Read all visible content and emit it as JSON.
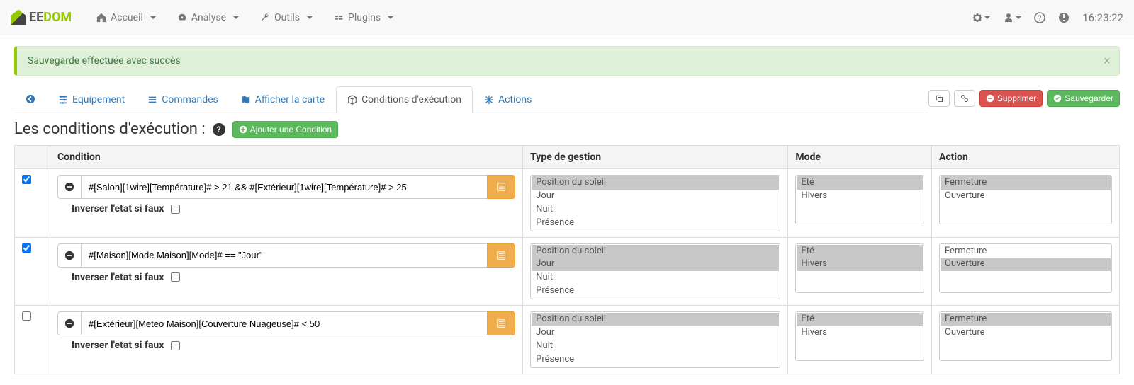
{
  "nav": {
    "home": "Accueil",
    "analyse": "Analyse",
    "tools": "Outils",
    "plugins": "Plugins"
  },
  "topright": {
    "time": "16:23:22"
  },
  "alert": {
    "message": "Sauvegarde effectuée avec succès"
  },
  "tabs": {
    "equipment": "Equipement",
    "commands": "Commandes",
    "show_map": "Afficher la carte",
    "exec_conditions": "Conditions d'exécution",
    "actions": "Actions"
  },
  "buttons": {
    "delete": "Supprimer",
    "save": "Sauvegarder",
    "add_condition": "Ajouter une Condition"
  },
  "page_title": "Les conditions d'exécution :",
  "table_headers": {
    "condition": "Condition",
    "gestion": "Type de gestion",
    "mode": "Mode",
    "action": "Action"
  },
  "invert_label": "Inverser l'etat si faux",
  "gestion_options": [
    "Position du soleil",
    "Jour",
    "Nuit",
    "Présence"
  ],
  "mode_options": [
    "Eté",
    "Hivers"
  ],
  "action_options": [
    "Fermeture",
    "Ouverture"
  ],
  "rows": [
    {
      "checked": true,
      "condition": "#[Salon][1wire][Température]# > 21 && #[Extérieur][1wire][Température]# > 25",
      "invert": false,
      "gestion_selected": [
        0
      ],
      "mode_selected": [
        0
      ],
      "action_selected": [
        0
      ]
    },
    {
      "checked": true,
      "condition": "#[Maison][Mode Maison][Mode]# == \"Jour\"",
      "invert": false,
      "gestion_selected": [
        0,
        1
      ],
      "mode_selected": [
        0,
        1
      ],
      "action_selected": [
        1
      ]
    },
    {
      "checked": false,
      "condition": "#[Extérieur][Meteo Maison][Couverture Nuageuse]# < 50",
      "invert": false,
      "gestion_selected": [
        0
      ],
      "mode_selected": [
        0
      ],
      "action_selected": [
        0
      ]
    }
  ]
}
